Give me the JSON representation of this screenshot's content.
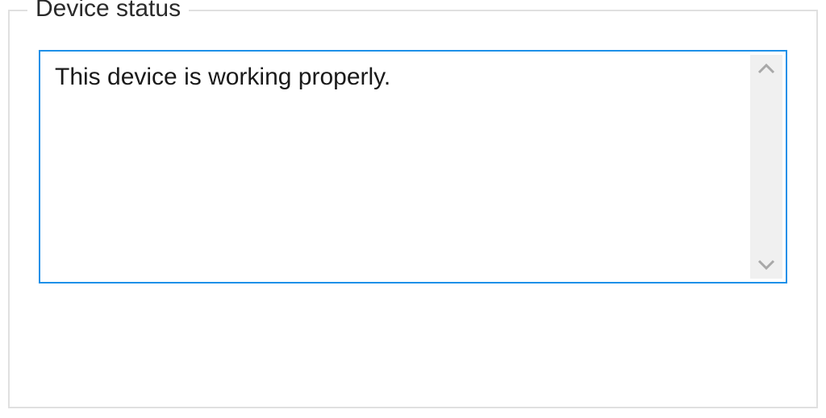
{
  "groupbox": {
    "title": "Device status"
  },
  "status": {
    "message": "This device is working properly."
  }
}
